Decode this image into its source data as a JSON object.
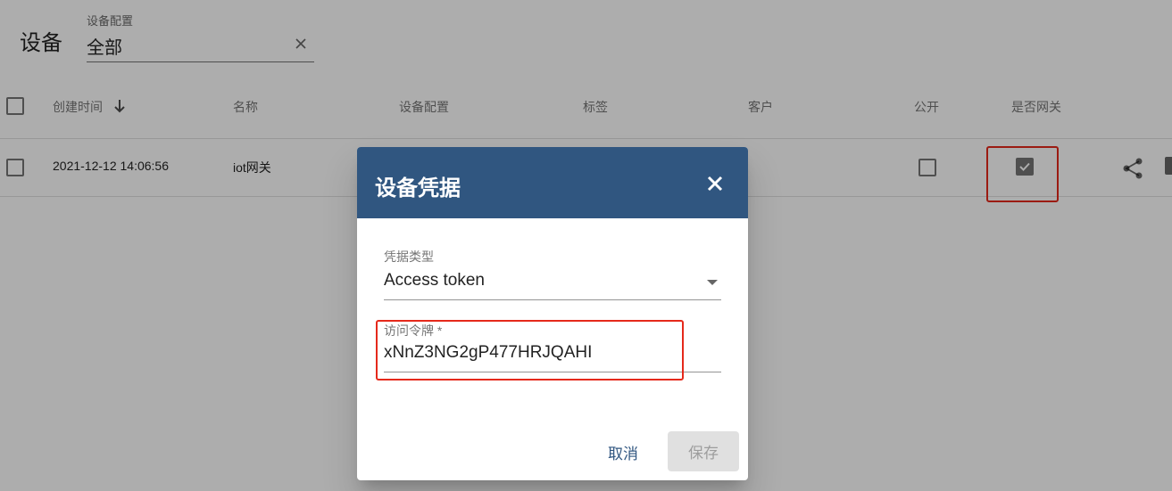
{
  "header": {
    "title": "设备",
    "filter": {
      "label": "设备配置",
      "value": "全部",
      "clear_icon": "close-icon"
    }
  },
  "table": {
    "columns": [
      "创建时间",
      "名称",
      "设备配置",
      "标签",
      "客户",
      "公开",
      "是否网关"
    ],
    "sort_icon": "arrow-down-icon",
    "rows": [
      {
        "created_time": "2021-12-12 14:06:56",
        "name": "iot网关",
        "public": false,
        "is_gateway": true,
        "actions": [
          "share-icon",
          "assign-icon"
        ]
      }
    ]
  },
  "dialog": {
    "title": "设备凭据",
    "close_icon": "close-icon",
    "credential_type": {
      "label": "凭据类型",
      "value": "Access token"
    },
    "access_token": {
      "label": "访问令牌 *",
      "value": "xNnZ3NG2gP477HRJQAHI"
    },
    "cancel_label": "取消",
    "save_label": "保存",
    "save_enabled": false
  },
  "colors": {
    "primary": "#305680",
    "highlight": "#e5291b",
    "overlay": "rgba(0,0,0,0.32)"
  }
}
